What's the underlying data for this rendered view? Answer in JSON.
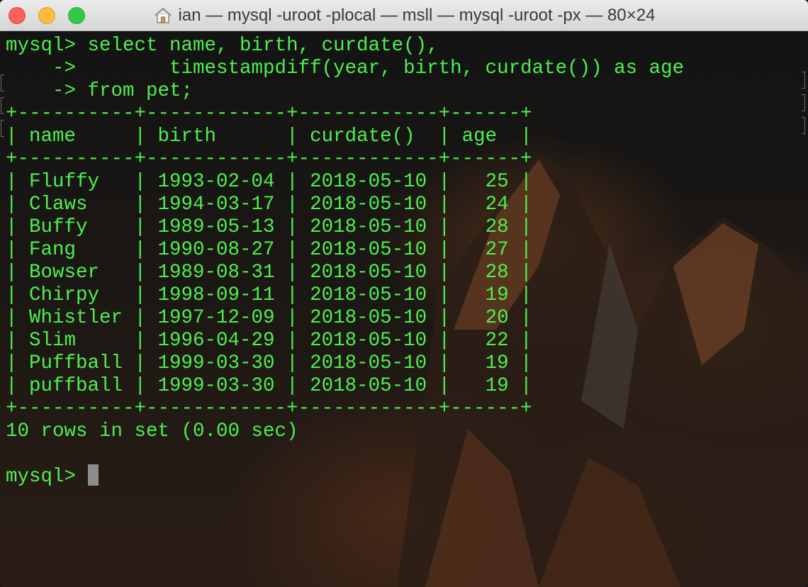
{
  "window": {
    "title": "ian — mysql -uroot -plocal — msll — mysql -uroot -px — 80×24",
    "icon": "home-icon",
    "controls": [
      "close-button",
      "minimize-button",
      "zoom-button"
    ]
  },
  "terminal": {
    "lines": [
      "mysql> select name, birth, curdate(),",
      "    ->        timestampdiff(year, birth, curdate()) as age",
      "    -> from pet;",
      "+----------+------------+------------+------+",
      "| name     | birth      | curdate()  | age  |",
      "+----------+------------+------------+------+",
      "| Fluffy   | 1993-02-04 | 2018-05-10 |   25 |",
      "| Claws    | 1994-03-17 | 2018-05-10 |   24 |",
      "| Buffy    | 1989-05-13 | 2018-05-10 |   28 |",
      "| Fang     | 1990-08-27 | 2018-05-10 |   27 |",
      "| Bowser   | 1989-08-31 | 2018-05-10 |   28 |",
      "| Chirpy   | 1998-09-11 | 2018-05-10 |   19 |",
      "| Whistler | 1997-12-09 | 2018-05-10 |   20 |",
      "| Slim     | 1996-04-29 | 2018-05-10 |   22 |",
      "| Puffball | 1999-03-30 | 2018-05-10 |   19 |",
      "| puffball | 1999-03-30 | 2018-05-10 |   19 |",
      "+----------+------------+------------+------+",
      "10 rows in set (0.00 sec)",
      "",
      "mysql> "
    ],
    "text_color": "#4df04d",
    "cursor_color": "#8d8d8d"
  }
}
